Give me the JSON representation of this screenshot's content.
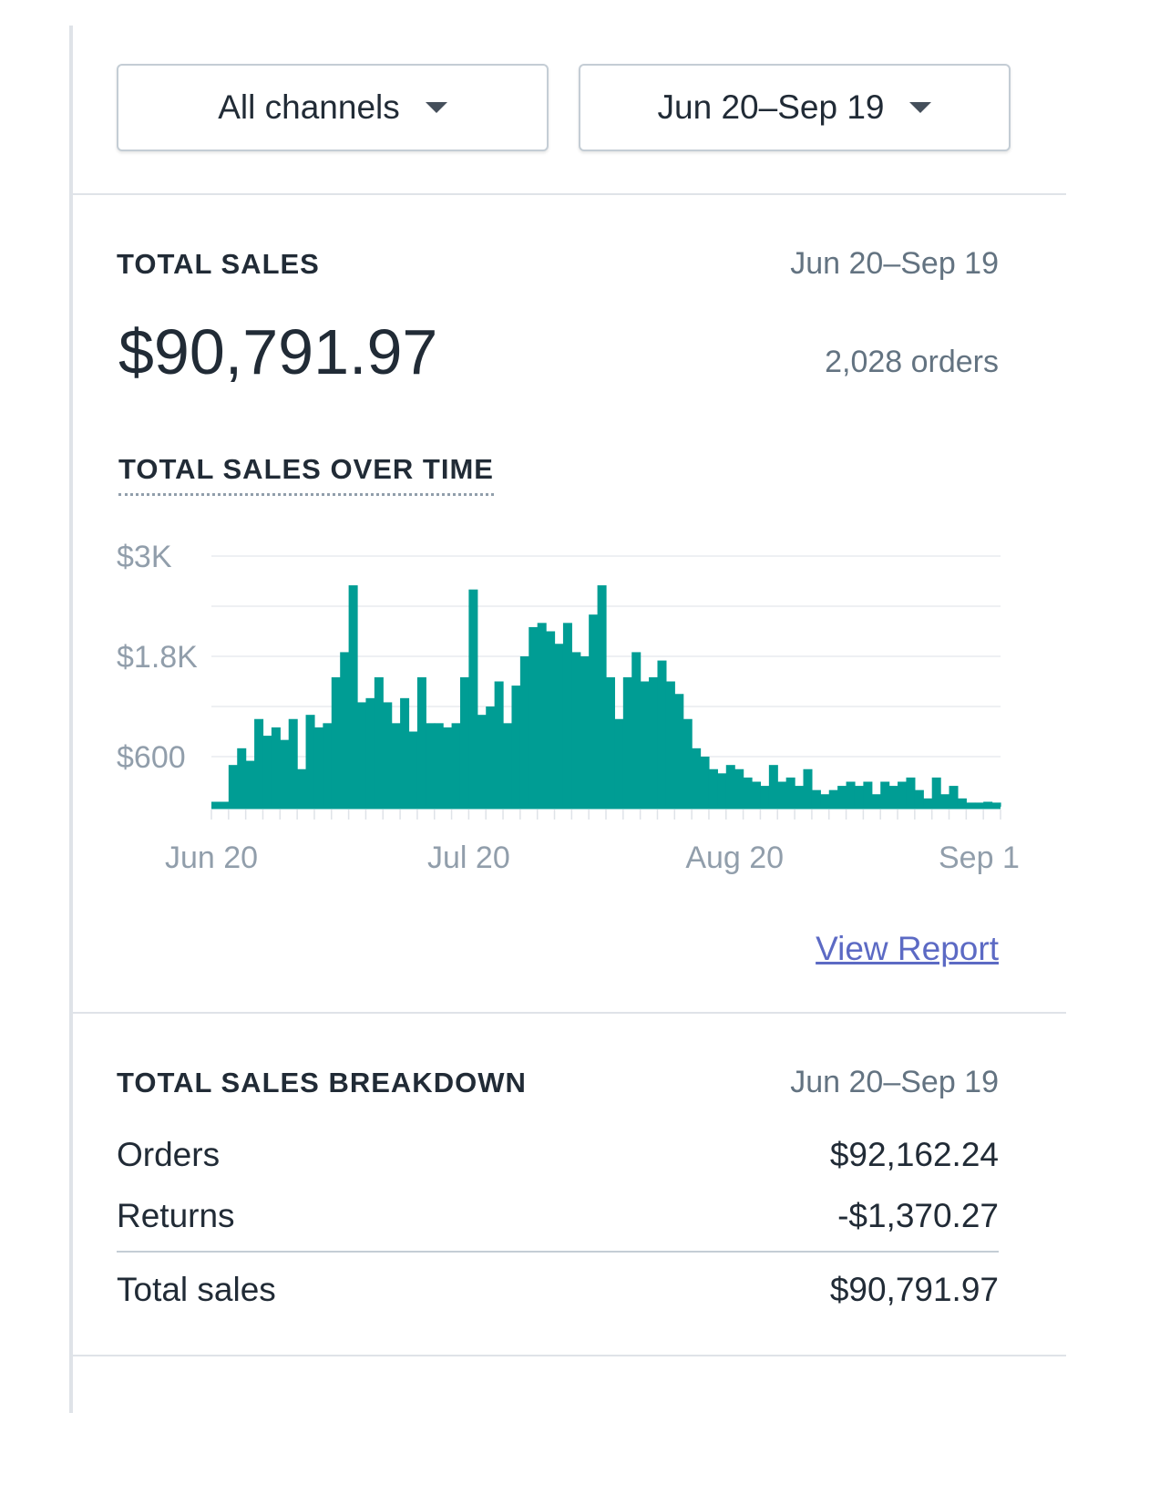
{
  "filters": {
    "channel_label": "All channels",
    "date_label": "Jun 20–Sep 19"
  },
  "total_sales": {
    "title": "TOTAL SALES",
    "date_range": "Jun 20–Sep 19",
    "amount": "$90,791.97",
    "orders": "2,028 orders"
  },
  "chart_title": "TOTAL SALES OVER TIME",
  "chart_data": {
    "type": "bar",
    "title": "TOTAL SALES OVER TIME",
    "xlabel": "",
    "ylabel": "",
    "y_tick_labels": [
      "$3K",
      "$1.8K",
      "$600"
    ],
    "y_ticks": [
      3000,
      1800,
      600
    ],
    "ylim": [
      0,
      3000
    ],
    "grid": true,
    "color": "#009d94",
    "x_tick_labels": [
      "Jun 20",
      "Jul 20",
      "Aug 20",
      "Sep 1"
    ],
    "x_tick_index": [
      0,
      30,
      61,
      91
    ],
    "categories": [
      "Jun 20",
      "Jun 21",
      "Jun 22",
      "Jun 23",
      "Jun 24",
      "Jun 25",
      "Jun 26",
      "Jun 27",
      "Jun 28",
      "Jun 29",
      "Jun 30",
      "Jul 1",
      "Jul 2",
      "Jul 3",
      "Jul 4",
      "Jul 5",
      "Jul 6",
      "Jul 7",
      "Jul 8",
      "Jul 9",
      "Jul 10",
      "Jul 11",
      "Jul 12",
      "Jul 13",
      "Jul 14",
      "Jul 15",
      "Jul 16",
      "Jul 17",
      "Jul 18",
      "Jul 19",
      "Jul 20",
      "Jul 21",
      "Jul 22",
      "Jul 23",
      "Jul 24",
      "Jul 25",
      "Jul 26",
      "Jul 27",
      "Jul 28",
      "Jul 29",
      "Jul 30",
      "Jul 31",
      "Aug 1",
      "Aug 2",
      "Aug 3",
      "Aug 4",
      "Aug 5",
      "Aug 6",
      "Aug 7",
      "Aug 8",
      "Aug 9",
      "Aug 10",
      "Aug 11",
      "Aug 12",
      "Aug 13",
      "Aug 14",
      "Aug 15",
      "Aug 16",
      "Aug 17",
      "Aug 18",
      "Aug 19",
      "Aug 20",
      "Aug 21",
      "Aug 22",
      "Aug 23",
      "Aug 24",
      "Aug 25",
      "Aug 26",
      "Aug 27",
      "Aug 28",
      "Aug 29",
      "Aug 30",
      "Aug 31",
      "Sep 1",
      "Sep 2",
      "Sep 3",
      "Sep 4",
      "Sep 5",
      "Sep 6",
      "Sep 7",
      "Sep 8",
      "Sep 9",
      "Sep 10",
      "Sep 11",
      "Sep 12",
      "Sep 13",
      "Sep 14",
      "Sep 15",
      "Sep 16",
      "Sep 17",
      "Sep 18",
      "Sep 19"
    ],
    "values": [
      60,
      60,
      500,
      700,
      550,
      1050,
      850,
      950,
      800,
      1050,
      450,
      1100,
      950,
      1000,
      1550,
      1850,
      2650,
      1250,
      1300,
      1550,
      1250,
      1000,
      1300,
      900,
      1550,
      1000,
      1000,
      950,
      1000,
      1550,
      2600,
      1100,
      1200,
      1500,
      1000,
      1450,
      1800,
      2150,
      2200,
      2100,
      1950,
      2200,
      1850,
      1800,
      2300,
      2650,
      1550,
      1050,
      1550,
      1850,
      1500,
      1550,
      1750,
      1500,
      1350,
      1050,
      700,
      600,
      450,
      400,
      500,
      450,
      350,
      300,
      250,
      500,
      300,
      350,
      250,
      450,
      200,
      150,
      200,
      250,
      300,
      250,
      300,
      150,
      300,
      250,
      300,
      350,
      200,
      100,
      350,
      150,
      250,
      100,
      50,
      50,
      60,
      50
    ]
  },
  "view_report": "View Report",
  "breakdown": {
    "title": "TOTAL SALES BREAKDOWN",
    "date_range": "Jun 20–Sep 19",
    "rows": [
      {
        "label": "Orders",
        "value": "$92,162.24"
      },
      {
        "label": "Returns",
        "value": "-$1,370.27"
      },
      {
        "label": "Total sales",
        "value": "$90,791.97"
      }
    ]
  }
}
